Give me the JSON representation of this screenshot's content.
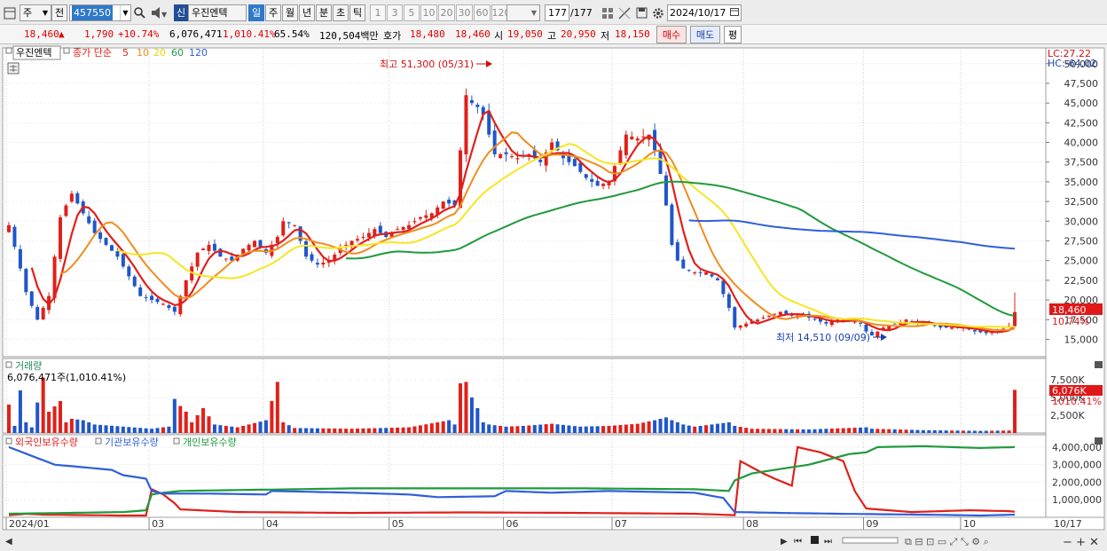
{
  "toolbar": {
    "market": "주",
    "prev_label": "전",
    "code": "457550",
    "credit_label": "신",
    "stock_name": "우진엔텍",
    "periods": [
      "일",
      "주",
      "월",
      "년",
      "분",
      "초",
      "틱"
    ],
    "active_period": "일",
    "minute_units": [
      "1",
      "3",
      "5",
      "10",
      "20",
      "30",
      "60",
      "120"
    ],
    "count_current": "177",
    "count_total": "/177",
    "date": "2024/10/17"
  },
  "quote": {
    "price": "18,460",
    "arrow": "▲",
    "change": "1,790",
    "change_pct": "+10.74%",
    "volume": "6,076,471",
    "volume_ratio": "1,010.41%",
    "turnover": "65.54%",
    "amount": "120,504백만",
    "ask_label": "호가",
    "ask1": "18,480",
    "ask2": "18,460",
    "open_label": "시",
    "open": "19,050",
    "high_label": "고",
    "high": "20,950",
    "low_label": "저",
    "low": "18,150",
    "buy_label": "매수",
    "sell_label": "매도",
    "flat_label": "평"
  },
  "price_panel": {
    "name_tag": "우진엔텍",
    "legend_prefix": "종가 단순",
    "ma_periods": [
      "5",
      "10",
      "20",
      "60",
      "120"
    ],
    "lc": "LC:27.22",
    "hc": "HC:-64.02",
    "max_label": "최고 51,300 (05/31)",
    "min_label": "최저 14,510 (09/09)",
    "last_price": "18,460",
    "last_pct": "10.74%",
    "colors": {
      "up": "#e0201a",
      "down": "#1f56c9",
      "ma5": "#e0201a",
      "ma10": "#f08c1c",
      "ma20": "#f5e622",
      "ma60": "#1f9a3c",
      "ma120": "#2f5fd9"
    }
  },
  "volume_panel": {
    "title": "거래량",
    "value_text": "6,076,471주(1,010.41%)",
    "axis_ticks": [
      "7,500K",
      "5,000K",
      "2,500K"
    ],
    "last_value": "6,076K",
    "last_pct": "1010.41%"
  },
  "holdings_panel": {
    "legend": [
      "외국인보유수량",
      "기관보유수량",
      "개인보유수량"
    ],
    "axis_ticks": [
      "4,000,000",
      "3,000,000",
      "2,000,000",
      "1,000,000"
    ]
  },
  "x_axis": {
    "labels": [
      "2024/01",
      "03",
      "04",
      "05",
      "06",
      "07",
      "08",
      "09",
      "10"
    ],
    "right_label": "10/17"
  },
  "chart_data": {
    "type": "candlestick",
    "y_ticks": [
      50000,
      47500,
      45000,
      42500,
      40000,
      37500,
      35000,
      32500,
      30000,
      27500,
      25000,
      22500,
      20000,
      17500,
      15000
    ],
    "ylim": [
      12800,
      52000
    ],
    "annotations": [
      {
        "text": "최고 51,300 (05/31)",
        "value": 51300,
        "date": "05/31"
      },
      {
        "text": "최저 14,510 (09/09)",
        "value": 14510,
        "date": "09/09"
      }
    ],
    "month_starts": {
      "2024/01": 0,
      "03": 25,
      "04": 45,
      "05": 67,
      "06": 87,
      "07": 106,
      "08": 129,
      "09": 150,
      "10": 167
    },
    "price_anchors": [
      [
        0,
        29500
      ],
      [
        2,
        24000
      ],
      [
        3,
        21000
      ],
      [
        5,
        17500
      ],
      [
        7,
        20500
      ],
      [
        9,
        30500
      ],
      [
        11,
        33500
      ],
      [
        13,
        31000
      ],
      [
        15,
        28500
      ],
      [
        17,
        27000
      ],
      [
        19,
        25500
      ],
      [
        21,
        23000
      ],
      [
        23,
        20500
      ],
      [
        25,
        20000
      ],
      [
        27,
        19500
      ],
      [
        29,
        18500
      ],
      [
        31,
        22500
      ],
      [
        33,
        26000
      ],
      [
        35,
        27000
      ],
      [
        37,
        25500
      ],
      [
        39,
        25000
      ],
      [
        41,
        26500
      ],
      [
        43,
        27500
      ],
      [
        45,
        26000
      ],
      [
        47,
        28000
      ],
      [
        48,
        30000
      ],
      [
        50,
        29500
      ],
      [
        52,
        25500
      ],
      [
        54,
        24500
      ],
      [
        56,
        25000
      ],
      [
        58,
        26500
      ],
      [
        60,
        27500
      ],
      [
        62,
        28000
      ],
      [
        64,
        29000
      ],
      [
        66,
        28000
      ],
      [
        68,
        29000
      ],
      [
        70,
        29500
      ],
      [
        72,
        30500
      ],
      [
        74,
        31000
      ],
      [
        76,
        32500
      ],
      [
        78,
        32000
      ],
      [
        79,
        39000
      ],
      [
        80,
        46000
      ],
      [
        81,
        45000
      ],
      [
        82,
        44500
      ],
      [
        83,
        43500
      ],
      [
        84,
        41000
      ],
      [
        85,
        38500
      ],
      [
        87,
        38500
      ],
      [
        89,
        38000
      ],
      [
        91,
        38500
      ],
      [
        93,
        37500
      ],
      [
        95,
        40000
      ],
      [
        97,
        38000
      ],
      [
        99,
        37000
      ],
      [
        101,
        35500
      ],
      [
        103,
        34500
      ],
      [
        105,
        35000
      ],
      [
        106,
        37000
      ],
      [
        108,
        41000
      ],
      [
        110,
        40500
      ],
      [
        112,
        41000
      ],
      [
        113,
        39000
      ],
      [
        114,
        36000
      ],
      [
        115,
        32000
      ],
      [
        116,
        27000
      ],
      [
        117,
        25000
      ],
      [
        118,
        24000
      ],
      [
        120,
        23500
      ],
      [
        122,
        23500
      ],
      [
        124,
        22500
      ],
      [
        126,
        19000
      ],
      [
        127,
        16500
      ],
      [
        129,
        17000
      ],
      [
        131,
        17500
      ],
      [
        133,
        18000
      ],
      [
        135,
        18500
      ],
      [
        137,
        18000
      ],
      [
        139,
        18000
      ],
      [
        141,
        17500
      ],
      [
        143,
        17000
      ],
      [
        145,
        17500
      ],
      [
        147,
        17500
      ],
      [
        149,
        17000
      ],
      [
        150,
        16000
      ],
      [
        151,
        15500
      ],
      [
        153,
        16500
      ],
      [
        155,
        17000
      ],
      [
        157,
        17500
      ],
      [
        159,
        17000
      ],
      [
        161,
        17000
      ],
      [
        163,
        16500
      ],
      [
        165,
        16500
      ],
      [
        167,
        16500
      ],
      [
        169,
        16000
      ],
      [
        171,
        15800
      ],
      [
        173,
        16000
      ],
      [
        175,
        16700
      ],
      [
        176,
        18460
      ]
    ],
    "volume_anchors": [
      [
        0,
        4000
      ],
      [
        1,
        1000
      ],
      [
        2,
        6000
      ],
      [
        3,
        1500
      ],
      [
        4,
        800
      ],
      [
        6,
        7800
      ],
      [
        7,
        3000
      ],
      [
        9,
        4500
      ],
      [
        10,
        1500
      ],
      [
        11,
        2000
      ],
      [
        13,
        1800
      ],
      [
        15,
        1200
      ],
      [
        20,
        900
      ],
      [
        25,
        600
      ],
      [
        28,
        900
      ],
      [
        29,
        4800
      ],
      [
        30,
        3800
      ],
      [
        31,
        3000
      ],
      [
        32,
        1500
      ],
      [
        34,
        3500
      ],
      [
        36,
        1200
      ],
      [
        40,
        800
      ],
      [
        45,
        1800
      ],
      [
        47,
        7200
      ],
      [
        48,
        1500
      ],
      [
        50,
        700
      ],
      [
        60,
        600
      ],
      [
        70,
        800
      ],
      [
        75,
        1500
      ],
      [
        77,
        1800
      ],
      [
        78,
        1200
      ],
      [
        79,
        7000
      ],
      [
        80,
        7200
      ],
      [
        81,
        5000
      ],
      [
        82,
        3500
      ],
      [
        83,
        1500
      ],
      [
        84,
        1200
      ],
      [
        87,
        900
      ],
      [
        90,
        1000
      ],
      [
        95,
        1300
      ],
      [
        100,
        900
      ],
      [
        105,
        1000
      ],
      [
        110,
        1300
      ],
      [
        113,
        1800
      ],
      [
        115,
        2200
      ],
      [
        116,
        1800
      ],
      [
        118,
        1200
      ],
      [
        120,
        900
      ],
      [
        126,
        1500
      ],
      [
        127,
        1000
      ],
      [
        130,
        600
      ],
      [
        140,
        500
      ],
      [
        150,
        800
      ],
      [
        151,
        600
      ],
      [
        160,
        400
      ],
      [
        170,
        300
      ],
      [
        175,
        350
      ],
      [
        176,
        6076
      ]
    ],
    "holding_series": [
      {
        "name": "외국인보유수량",
        "color": "#e0201a",
        "anchors": [
          [
            0,
            120000
          ],
          [
            3,
            200000
          ],
          [
            6,
            150000
          ],
          [
            20,
            100000
          ],
          [
            24,
            100000
          ],
          [
            25,
            1600000
          ],
          [
            27,
            1300000
          ],
          [
            29,
            800000
          ],
          [
            30,
            450000
          ],
          [
            40,
            300000
          ],
          [
            60,
            250000
          ],
          [
            80,
            280000
          ],
          [
            100,
            250000
          ],
          [
            120,
            200000
          ],
          [
            127,
            120000
          ],
          [
            128,
            3200000
          ],
          [
            132,
            2500000
          ],
          [
            134,
            2200000
          ],
          [
            137,
            1800000
          ],
          [
            138,
            4000000
          ],
          [
            142,
            3700000
          ],
          [
            146,
            3200000
          ],
          [
            148,
            1500000
          ],
          [
            150,
            500000
          ],
          [
            158,
            300000
          ],
          [
            168,
            400000
          ],
          [
            175,
            350000
          ],
          [
            176,
            320000
          ]
        ]
      },
      {
        "name": "기관보유수량",
        "color": "#1f9a3c",
        "anchors": [
          [
            0,
            200000
          ],
          [
            10,
            250000
          ],
          [
            20,
            300000
          ],
          [
            24,
            400000
          ],
          [
            25,
            1300000
          ],
          [
            27,
            1400000
          ],
          [
            30,
            1500000
          ],
          [
            40,
            1550000
          ],
          [
            60,
            1650000
          ],
          [
            80,
            1650000
          ],
          [
            100,
            1650000
          ],
          [
            120,
            1600000
          ],
          [
            126,
            1500000
          ],
          [
            127,
            2100000
          ],
          [
            130,
            2500000
          ],
          [
            140,
            3000000
          ],
          [
            147,
            3600000
          ],
          [
            150,
            3700000
          ],
          [
            152,
            4000000
          ],
          [
            160,
            4050000
          ],
          [
            170,
            3950000
          ],
          [
            176,
            4000000
          ]
        ]
      },
      {
        "name": "개인보유수량",
        "color": "#2f5fd9",
        "anchors": [
          [
            0,
            4000000
          ],
          [
            4,
            3500000
          ],
          [
            8,
            3000000
          ],
          [
            18,
            2700000
          ],
          [
            20,
            2400000
          ],
          [
            24,
            2200000
          ],
          [
            25,
            1500000
          ],
          [
            27,
            1350000
          ],
          [
            35,
            1350000
          ],
          [
            45,
            1300000
          ],
          [
            46,
            1500000
          ],
          [
            60,
            1400000
          ],
          [
            70,
            1300000
          ],
          [
            75,
            1150000
          ],
          [
            85,
            1200000
          ],
          [
            87,
            1500000
          ],
          [
            95,
            1400000
          ],
          [
            105,
            1500000
          ],
          [
            120,
            1400000
          ],
          [
            125,
            1100000
          ],
          [
            127,
            300000
          ],
          [
            135,
            250000
          ],
          [
            145,
            200000
          ],
          [
            160,
            150000
          ],
          [
            170,
            100000
          ],
          [
            176,
            150000
          ]
        ]
      }
    ]
  }
}
